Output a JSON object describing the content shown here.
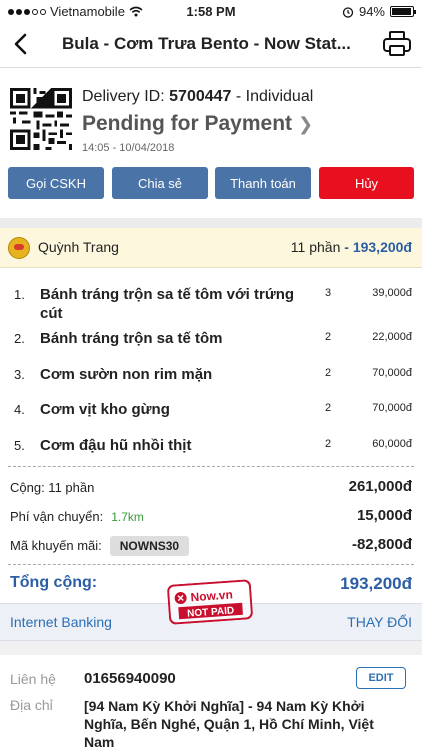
{
  "status_bar": {
    "carrier": "Vietnamobile",
    "time": "1:58 PM",
    "battery": "94%",
    "battery_level": 0.94
  },
  "nav": {
    "title": "Bula - Cơm Trưa Bento - Now Stat..."
  },
  "order": {
    "delivery_label": "Delivery ID:",
    "delivery_id": "5700447",
    "delivery_type": "- Individual",
    "status": "Pending for Payment",
    "timestamp": "14:05 - 10/04/2018"
  },
  "actions": {
    "call": "Gọi CSKH",
    "share": "Chia sẻ",
    "pay": "Thanh toán",
    "cancel": "Hủy"
  },
  "buyer": {
    "name": "Quỳnh Trang",
    "portions": "11 phần",
    "dash": "-",
    "amount": "193,200đ"
  },
  "items": [
    {
      "num": "1.",
      "name": "Bánh tráng trộn sa tế tôm với trứng cút",
      "qty": "3",
      "price": "39,000đ"
    },
    {
      "num": "2.",
      "name": "Bánh tráng trộn sa tế tôm",
      "qty": "2",
      "price": "22,000đ"
    },
    {
      "num": "3.",
      "name": "Cơm sườn non rim mặn",
      "qty": "2",
      "price": "70,000đ"
    },
    {
      "num": "4.",
      "name": "Cơm vịt kho gừng",
      "qty": "2",
      "price": "70,000đ"
    },
    {
      "num": "5.",
      "name": "Cơm đậu hũ nhồi thịt",
      "qty": "2",
      "price": "60,000đ"
    }
  ],
  "summary": {
    "subtotal_label": "Cộng: 11 phần",
    "subtotal": "261,000đ",
    "shipping_label": "Phí vận chuyển:",
    "distance": "1.7km",
    "shipping": "15,000đ",
    "coupon_label": "Mã khuyến mãi:",
    "coupon_code": "NOWNS30",
    "discount": "-82,800đ",
    "total_label": "Tổng cộng:",
    "total": "193,200đ"
  },
  "stamp": {
    "brand": "Now.vn",
    "text": "NOT PAID"
  },
  "payment": {
    "method": "Internet Banking",
    "change": "THAY ĐỔI"
  },
  "contact": {
    "label": "Liên hệ",
    "phone": "01656940090",
    "edit": "EDIT",
    "address_label": "Địa chỉ",
    "address": "[94 Nam Kỳ Khởi Nghĩa] - 94 Nam Kỳ Khởi Nghĩa, Bến Nghé, Quận 1, Hồ Chí Minh, Việt Nam"
  },
  "colors": {
    "accent": "#2b5ea5",
    "button_blue": "#4a73a8",
    "button_red": "#e8101e",
    "buyer_row": "#fdf8dd",
    "stamp_red": "#c8102e"
  },
  "icons": [
    "back-chevron-icon",
    "printer-icon",
    "qr-code-icon",
    "wifi-icon",
    "alarm-icon",
    "battery-icon",
    "avatar-icon",
    "chevron-right-icon"
  ]
}
